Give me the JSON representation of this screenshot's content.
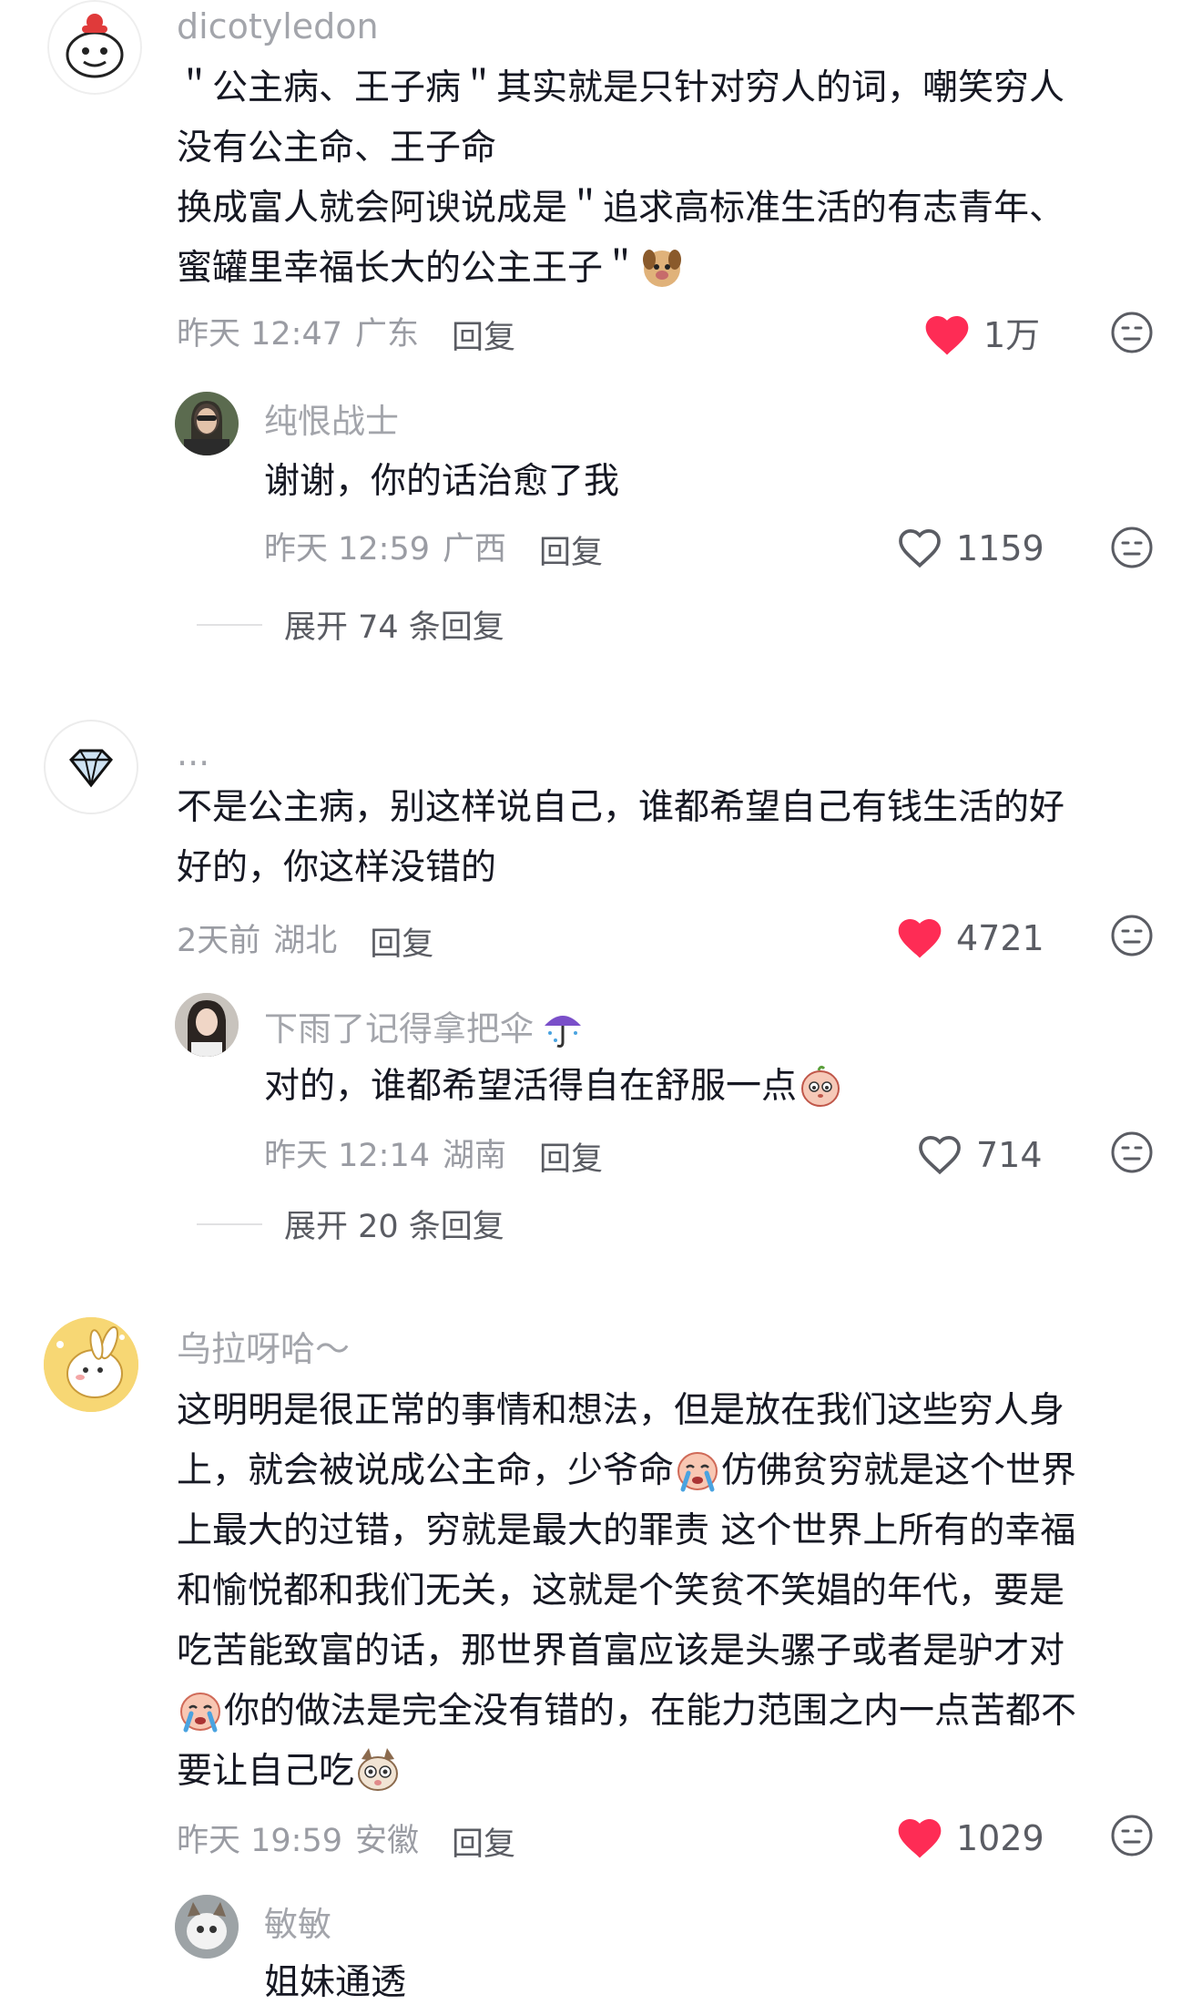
{
  "comments": [
    {
      "username": "dicotyledon",
      "lines": [
        "＂公主病、王子病＂其实就是只针对穷人的词，嘲笑穷人",
        "没有公主命、王子命",
        "换成富人就会阿谀说成是＂追求高标准生活的有志青年、",
        "蜜罐里幸福长大的公主王子＂"
      ],
      "time": "昨天 12:47",
      "region": "广东",
      "reply_label": "回复",
      "likes": "1万",
      "liked": true,
      "replies": [
        {
          "username": "纯恨战士",
          "text": "谢谢，你的话治愈了我",
          "time": "昨天 12:59",
          "region": "广西",
          "reply_label": "回复",
          "likes": "1159",
          "liked": false
        }
      ],
      "expand_label": "展开 74 条回复"
    },
    {
      "username": "...",
      "lines": [
        "不是公主病，别这样说自己，谁都希望自己有钱生活的好",
        "好的，你这样没错的"
      ],
      "time": "2天前",
      "region": "湖北",
      "reply_label": "回复",
      "likes": "4721",
      "liked": true,
      "replies": [
        {
          "username": "下雨了记得拿把伞",
          "text": "对的，谁都希望活得自在舒服一点",
          "time": "昨天 12:14",
          "region": "湖南",
          "reply_label": "回复",
          "likes": "714",
          "liked": false
        }
      ],
      "expand_label": "展开 20 条回复"
    },
    {
      "username": "乌拉呀哈～",
      "lines": [
        "这明明是很正常的事情和想法，但是放在我们这些穷人身",
        "上，就会被说成公主命，少爷命",
        "仿佛贫穷就是这个世界",
        "上最大的过错，穷就是最大的罪责 这个世界上所有的幸福",
        "和愉悦都和我们无关，这就是个笑贫不笑娼的年代，要是",
        "吃苦能致富的话，那世界首富应该是头骡子或者是驴才对",
        "你的做法是完全没有错的，在能力范围之内一点苦都不",
        "要让自己吃"
      ],
      "time": "昨天 19:59",
      "region": "安徽",
      "reply_label": "回复",
      "likes": "1029",
      "liked": true,
      "replies": [
        {
          "username": "敏敏",
          "text": "姐妹通透"
        }
      ]
    }
  ],
  "colors": {
    "like_red": "#fe2c55",
    "meta_gray": "#9a9ca3",
    "text": "#161823"
  },
  "icons": {
    "like": "heart-icon",
    "dislike": "dislike-face-icon",
    "emoji_dog": "dog-emoji",
    "emoji_umbrella": "umbrella-emoji",
    "emoji_bean": "bean-emoji",
    "emoji_cry": "cry-emoji",
    "emoji_cat": "cat-emoji"
  }
}
